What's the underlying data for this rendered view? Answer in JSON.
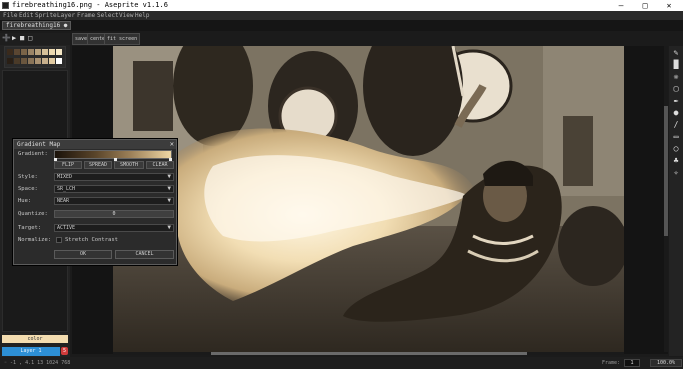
{
  "window": {
    "title": "firebreathing16.png - Aseprite v1.1.6",
    "minimize": "–",
    "maximize": "□",
    "close": "✕"
  },
  "menu": {
    "items": [
      "File",
      "Edit",
      "Sprite",
      "Layer",
      "Frame",
      "Select",
      "View",
      "Help"
    ]
  },
  "tabs": [
    {
      "label": "firebreathing16 ●"
    }
  ],
  "toolbar": {
    "icons": [
      "➕",
      "▶",
      "■",
      "□"
    ],
    "buttons": [
      "save",
      "center",
      "fit screen"
    ]
  },
  "palette": {
    "colors": [
      "#3a2a1c",
      "#5a4632",
      "#7a6448",
      "#9a8466",
      "#b8a27e",
      "#d6c19a",
      "#ecd9b0",
      "#f6e8c6",
      "#2a1f15",
      "#4a3a28",
      "#6a563e",
      "#8a7458",
      "#aa9272",
      "#c8b08c",
      "#e2cba2",
      "#ffffff"
    ]
  },
  "status_left": {
    "swatch_label": "color",
    "layer_label": "Layer 1",
    "layer_badge": "5"
  },
  "dialog": {
    "title": "Gradient Map",
    "close": "✕",
    "gradient_label": "Gradient:",
    "buttons": {
      "flip": "FLIP",
      "spread": "SPREAD",
      "smooth": "SMOOTH",
      "clear": "CLEAR"
    },
    "style_label": "Style:",
    "style_value": "MIXED",
    "space_label": "Space:",
    "space_value": "SR_LCH",
    "hue_label": "Hue:",
    "hue_value": "NEAR",
    "quantize_label": "Quantize:",
    "quantize_value": "0",
    "target_label": "Target:",
    "target_value": "ACTIVE",
    "normalize_label": "Normalize:",
    "stretch_label": "Stretch Contrast",
    "ok": "OK",
    "cancel": "CANCEL"
  },
  "statusbar": {
    "coords": "◦ -1 , 4.1 13 1024 768",
    "frame_label": "Frame:",
    "frame_value": "1",
    "zoom_value": "100.0%"
  },
  "right_tools": [
    "✎",
    "█",
    "❈",
    "▢",
    "✒",
    "●",
    "∕",
    "▭",
    "◯",
    "♣",
    "✧"
  ]
}
